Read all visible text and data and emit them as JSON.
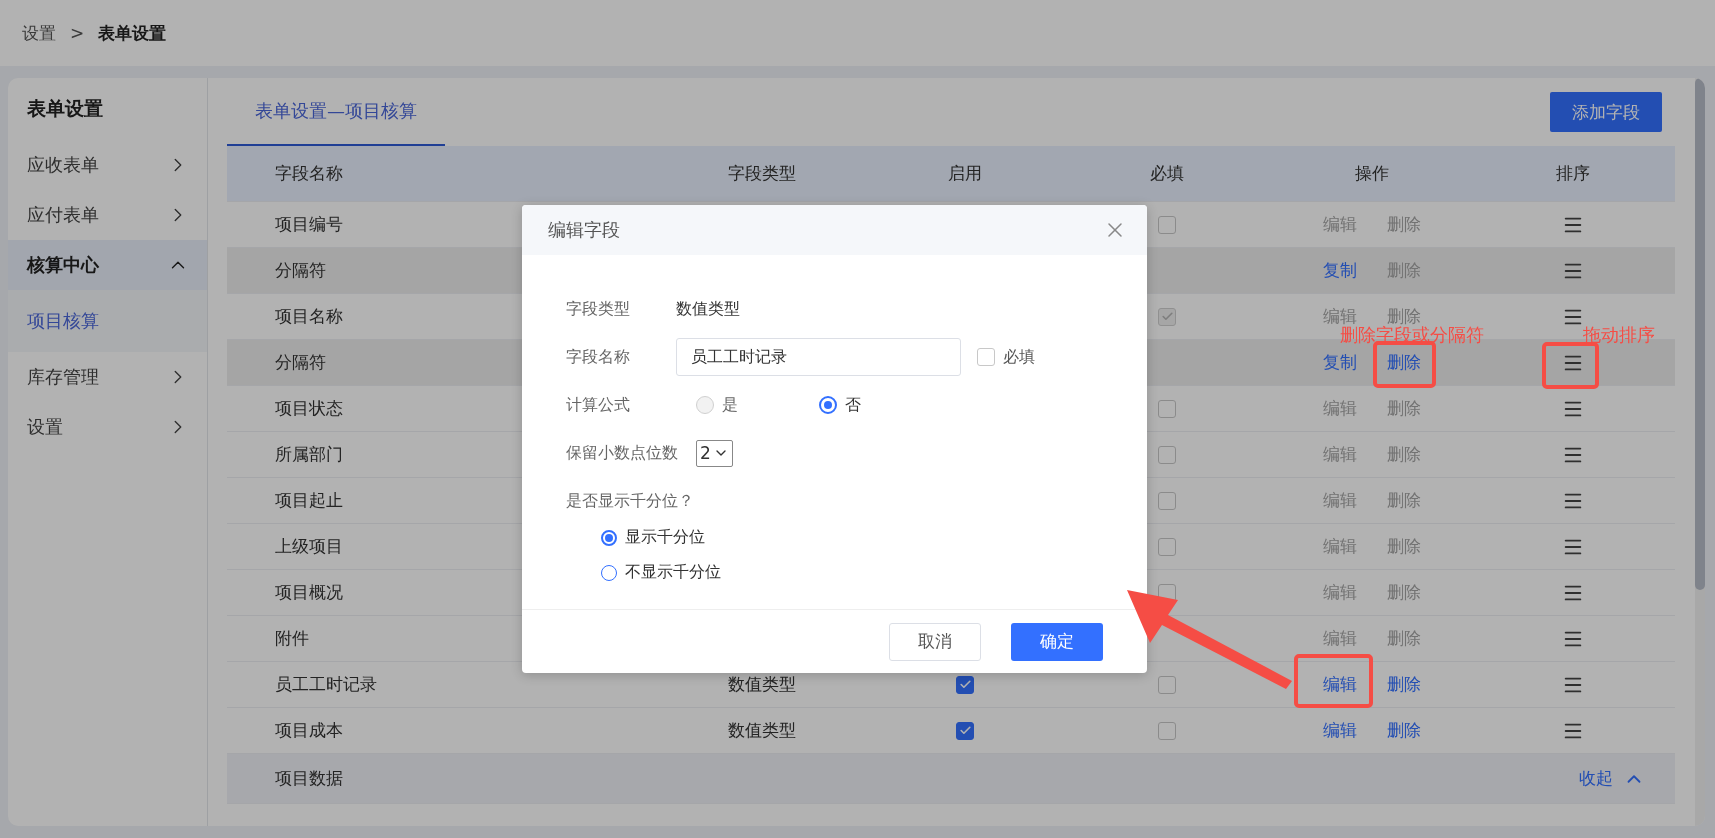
{
  "breadcrumb": {
    "items": [
      {
        "label": "设置",
        "current": false
      },
      {
        "label": "表单设置",
        "current": true
      }
    ],
    "separator": ">"
  },
  "sidebar": {
    "title": "表单设置",
    "items": [
      {
        "label": "应收表单",
        "expanded": false,
        "selected": false
      },
      {
        "label": "应付表单",
        "expanded": false,
        "selected": false
      },
      {
        "label": "核算中心",
        "expanded": true,
        "selected": true,
        "children": [
          {
            "label": "项目核算",
            "selected": true
          }
        ]
      },
      {
        "label": "库存管理",
        "expanded": false,
        "selected": false
      },
      {
        "label": "设置",
        "expanded": false,
        "selected": false
      }
    ]
  },
  "tabs": [
    {
      "label": "表单设置—项目核算",
      "selected": true
    }
  ],
  "add_button": "添加字段",
  "table": {
    "columns": [
      "字段名称",
      "字段类型",
      "启用",
      "必填",
      "操作",
      "排序"
    ],
    "rows": [
      {
        "kind": "field",
        "name": "项目编号",
        "required": {
          "checked": false,
          "disabled": false
        },
        "actions": [
          {
            "label": "编辑",
            "disabled": true
          },
          {
            "label": "删除",
            "disabled": true
          }
        ]
      },
      {
        "kind": "separator",
        "name": "分隔符",
        "actions": [
          {
            "label": "复制",
            "disabled": false
          },
          {
            "label": "删除",
            "disabled": true
          }
        ]
      },
      {
        "kind": "field",
        "name": "项目名称",
        "required": {
          "checked": true,
          "disabled": true
        },
        "actions": [
          {
            "label": "编辑",
            "disabled": true
          },
          {
            "label": "删除",
            "disabled": true
          }
        ]
      },
      {
        "kind": "separator",
        "name": "分隔符",
        "actions": [
          {
            "label": "复制",
            "disabled": false
          },
          {
            "label": "删除",
            "disabled": false
          }
        ]
      },
      {
        "kind": "field",
        "name": "项目状态",
        "required": {
          "checked": false,
          "disabled": false
        },
        "actions": [
          {
            "label": "编辑",
            "disabled": true
          },
          {
            "label": "删除",
            "disabled": true
          }
        ]
      },
      {
        "kind": "field",
        "name": "所属部门",
        "required": {
          "checked": false,
          "disabled": false
        },
        "actions": [
          {
            "label": "编辑",
            "disabled": true
          },
          {
            "label": "删除",
            "disabled": true
          }
        ]
      },
      {
        "kind": "field",
        "name": "项目起止",
        "required": {
          "checked": false,
          "disabled": false
        },
        "actions": [
          {
            "label": "编辑",
            "disabled": true
          },
          {
            "label": "删除",
            "disabled": true
          }
        ]
      },
      {
        "kind": "field",
        "name": "上级项目",
        "required": {
          "checked": false,
          "disabled": false
        },
        "actions": [
          {
            "label": "编辑",
            "disabled": true
          },
          {
            "label": "删除",
            "disabled": true
          }
        ]
      },
      {
        "kind": "field",
        "name": "项目概况",
        "required": {
          "checked": false,
          "disabled": false
        },
        "actions": [
          {
            "label": "编辑",
            "disabled": true
          },
          {
            "label": "删除",
            "disabled": true
          }
        ]
      },
      {
        "kind": "field",
        "name": "附件",
        "actions": [
          {
            "label": "编辑",
            "disabled": true
          },
          {
            "label": "删除",
            "disabled": true
          }
        ]
      },
      {
        "kind": "field",
        "name": "员工工时记录",
        "type": "数值类型",
        "enabled": {
          "checked": true,
          "disabled": false
        },
        "required": {
          "checked": false,
          "disabled": false
        },
        "actions": [
          {
            "label": "编辑",
            "disabled": false
          },
          {
            "label": "删除",
            "disabled": false
          }
        ]
      },
      {
        "kind": "field",
        "name": "项目成本",
        "type": "数值类型",
        "enabled": {
          "checked": true,
          "disabled": false
        },
        "required": {
          "checked": false,
          "disabled": false
        },
        "actions": [
          {
            "label": "编辑",
            "disabled": false
          },
          {
            "label": "删除",
            "disabled": false
          }
        ]
      },
      {
        "kind": "group",
        "name": "项目数据",
        "toggle": "收起",
        "expanded": true
      }
    ]
  },
  "dialog": {
    "title": "编辑字段",
    "type_label": "字段类型",
    "type_value": "数值类型",
    "name_label": "字段名称",
    "name_value": "员工工时记录",
    "required": {
      "label": "必填",
      "checked": false
    },
    "formula": {
      "label": "计算公式",
      "options": [
        {
          "label": "是",
          "selected": false,
          "disabled": true
        },
        {
          "label": "否",
          "selected": true,
          "disabled": false
        }
      ]
    },
    "decimals": {
      "label": "保留小数点位数",
      "value": "2"
    },
    "thousands": {
      "label": "是否显示千分位？",
      "options": [
        {
          "label": "显示千分位",
          "selected": true
        },
        {
          "label": "不显示千分位",
          "selected": false
        }
      ]
    },
    "buttons": [
      {
        "label": "取消",
        "primary": false
      },
      {
        "label": "确定",
        "primary": true
      }
    ]
  },
  "annotations": {
    "labels": [
      "删除字段或分隔符",
      "拖动排序"
    ]
  }
}
